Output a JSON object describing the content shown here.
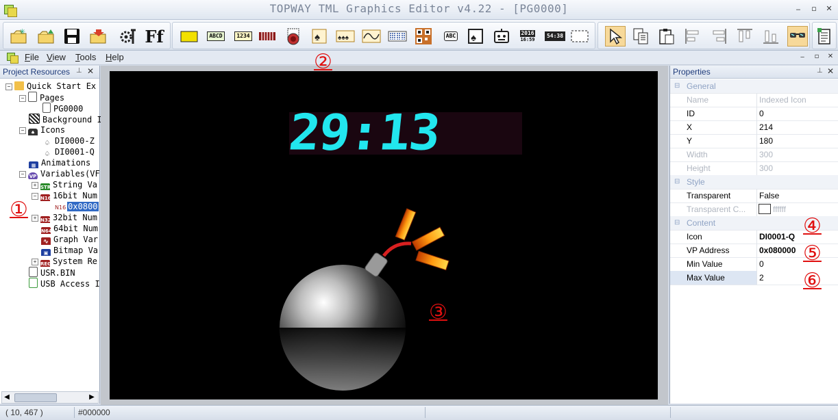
{
  "window": {
    "title": "TOPWAY TML Graphics Editor v4.22 - [PG0000]",
    "min_glyph": "‒",
    "max_glyph": "▫",
    "close_glyph": "✕"
  },
  "toolbar": {
    "labels": {
      "abcd": "ABCD",
      "num": "1234",
      "abc": "ABC",
      "year": "2016",
      "time_small": "16:59",
      "clock": "54:38",
      "ff": "Ff"
    },
    "icons": [
      "new-project-icon",
      "open-project-icon",
      "save-icon",
      "export-icon",
      "settings-icon",
      "font-icon",
      "rectangle-icon",
      "text-string-icon",
      "number-icon",
      "bargraph-icon",
      "button-icon",
      "indexed-icon-icon",
      "animation-icon",
      "graph-icon",
      "bitmap-icon",
      "qrcode-icon",
      "text-input-icon",
      "touch-icon",
      "robot-icon",
      "date-icon",
      "clock-icon",
      "region-icon",
      "pointer-icon",
      "copy-icon",
      "paste-icon",
      "align-left-icon",
      "align-right-icon",
      "align-top-icon",
      "align-bottom-icon",
      "preview-icon",
      "page-list-icon"
    ]
  },
  "menubar": {
    "items": [
      "File",
      "View",
      "Tools",
      "Help"
    ],
    "underline": [
      "F",
      "V",
      "T",
      "H"
    ]
  },
  "project_resources": {
    "title": "Project Resources",
    "pin_glyph": "📌",
    "close_glyph": "✕",
    "tree": {
      "root": "Quick Start Ex",
      "pages": "Pages",
      "page_pg0000": "PG0000",
      "background": "Background I",
      "icons": "Icons",
      "icon_1": "DI0000-Z",
      "icon_2": "DI0001-Q",
      "animations": "Animations",
      "variables": "Variables(VF",
      "string_var": "String Va",
      "num16": "16bit Num",
      "num16_item_tag": "N16",
      "num16_item": "0x0800",
      "num32": "32bit Num",
      "num64": "64bit Num",
      "graph_var": "Graph Var",
      "bitmap_var": "Bitmap Va",
      "system_reg": "System Re",
      "usr_bin": "USR.BIN",
      "usb_access": "USB Access I"
    },
    "badges": {
      "str": "STR",
      "n16": "N16",
      "n32": "N32",
      "n64": "N64",
      "reg": "REG",
      "vp": "VP"
    }
  },
  "canvas": {
    "timer_text": "29:13",
    "timer_color": "#22e6ee",
    "bg_color": "#000000"
  },
  "properties": {
    "title": "Properties",
    "categories": {
      "general": "General",
      "style": "Style",
      "content": "Content"
    },
    "rows": {
      "name": {
        "label": "Name",
        "value": "Indexed Icon"
      },
      "id": {
        "label": "ID",
        "value": "0"
      },
      "x": {
        "label": "X",
        "value": "214"
      },
      "y": {
        "label": "Y",
        "value": "180"
      },
      "width": {
        "label": "Width",
        "value": "300"
      },
      "height": {
        "label": "Height",
        "value": "300"
      },
      "transparent": {
        "label": "Transparent",
        "value": "False"
      },
      "transparent_color": {
        "label": "Transparent C...",
        "value": "ffffff"
      },
      "icon": {
        "label": "Icon",
        "value": "DI0001-Q"
      },
      "vp_address": {
        "label": "VP Address",
        "value": "0x080000"
      },
      "min_value": {
        "label": "Min Value",
        "value": "0"
      },
      "max_value": {
        "label": "Max Value",
        "value": "2"
      }
    }
  },
  "callouts": {
    "c1": "①",
    "c2": "②",
    "c3": "③",
    "c4": "④",
    "c5": "⑤",
    "c6": "⑥"
  },
  "statusbar": {
    "coords": "( 10, 467 )",
    "color": "#000000"
  },
  "colors": {
    "accent_red": "#e01010",
    "selection": "#316ac5",
    "header_text": "#1d3a7a"
  }
}
